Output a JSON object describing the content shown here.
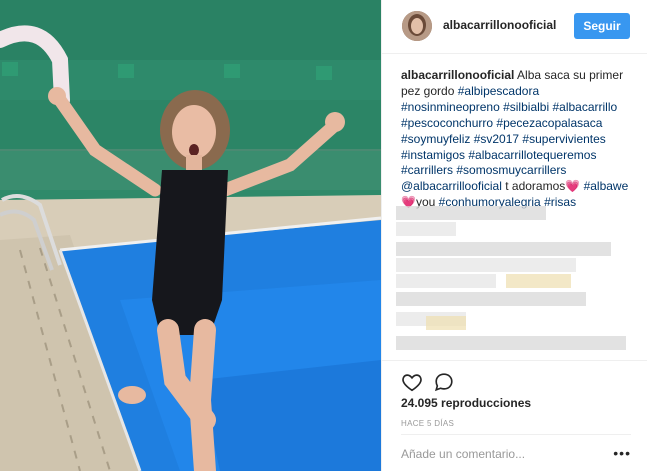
{
  "post": {
    "media_alt": "video",
    "username": "albacarrillonooficial",
    "follow_label": "Seguir",
    "caption": {
      "author": "albacarrillonooficial",
      "text_start": "Alba saca su primer pez gordo",
      "tags": [
        "#albipescadora",
        "#nosinmineopreno",
        "#silbialbi",
        "#albacarrillo",
        "#pescoconchurro",
        "#pecezacopalasaca",
        "#soymuyfeliz",
        "#sv2017",
        "#supervivientes",
        "#instamigos",
        "#albacarrillotequeremos",
        "#carrillers",
        "#somosmuycarrillers"
      ],
      "mention": "@albacarrillooficial",
      "mention_text": "t adoramos",
      "mention2": "#albawe",
      "you_text": "you",
      "tags2": [
        "#conhumoryalegria",
        "#risas"
      ],
      "heart": "💗"
    },
    "views": "24.095 reproducciones",
    "timestamp": "HACE 5 DÍAS",
    "comment_placeholder": "Añade un comentario...",
    "more_label": "•••",
    "icons": {
      "like": "heart-outline-icon",
      "comment": "speech-bubble-icon",
      "more": "ellipsis-icon"
    },
    "colors": {
      "follow": "#3897f0",
      "tag": "#003569",
      "heart": "#ff4fa0"
    }
  }
}
